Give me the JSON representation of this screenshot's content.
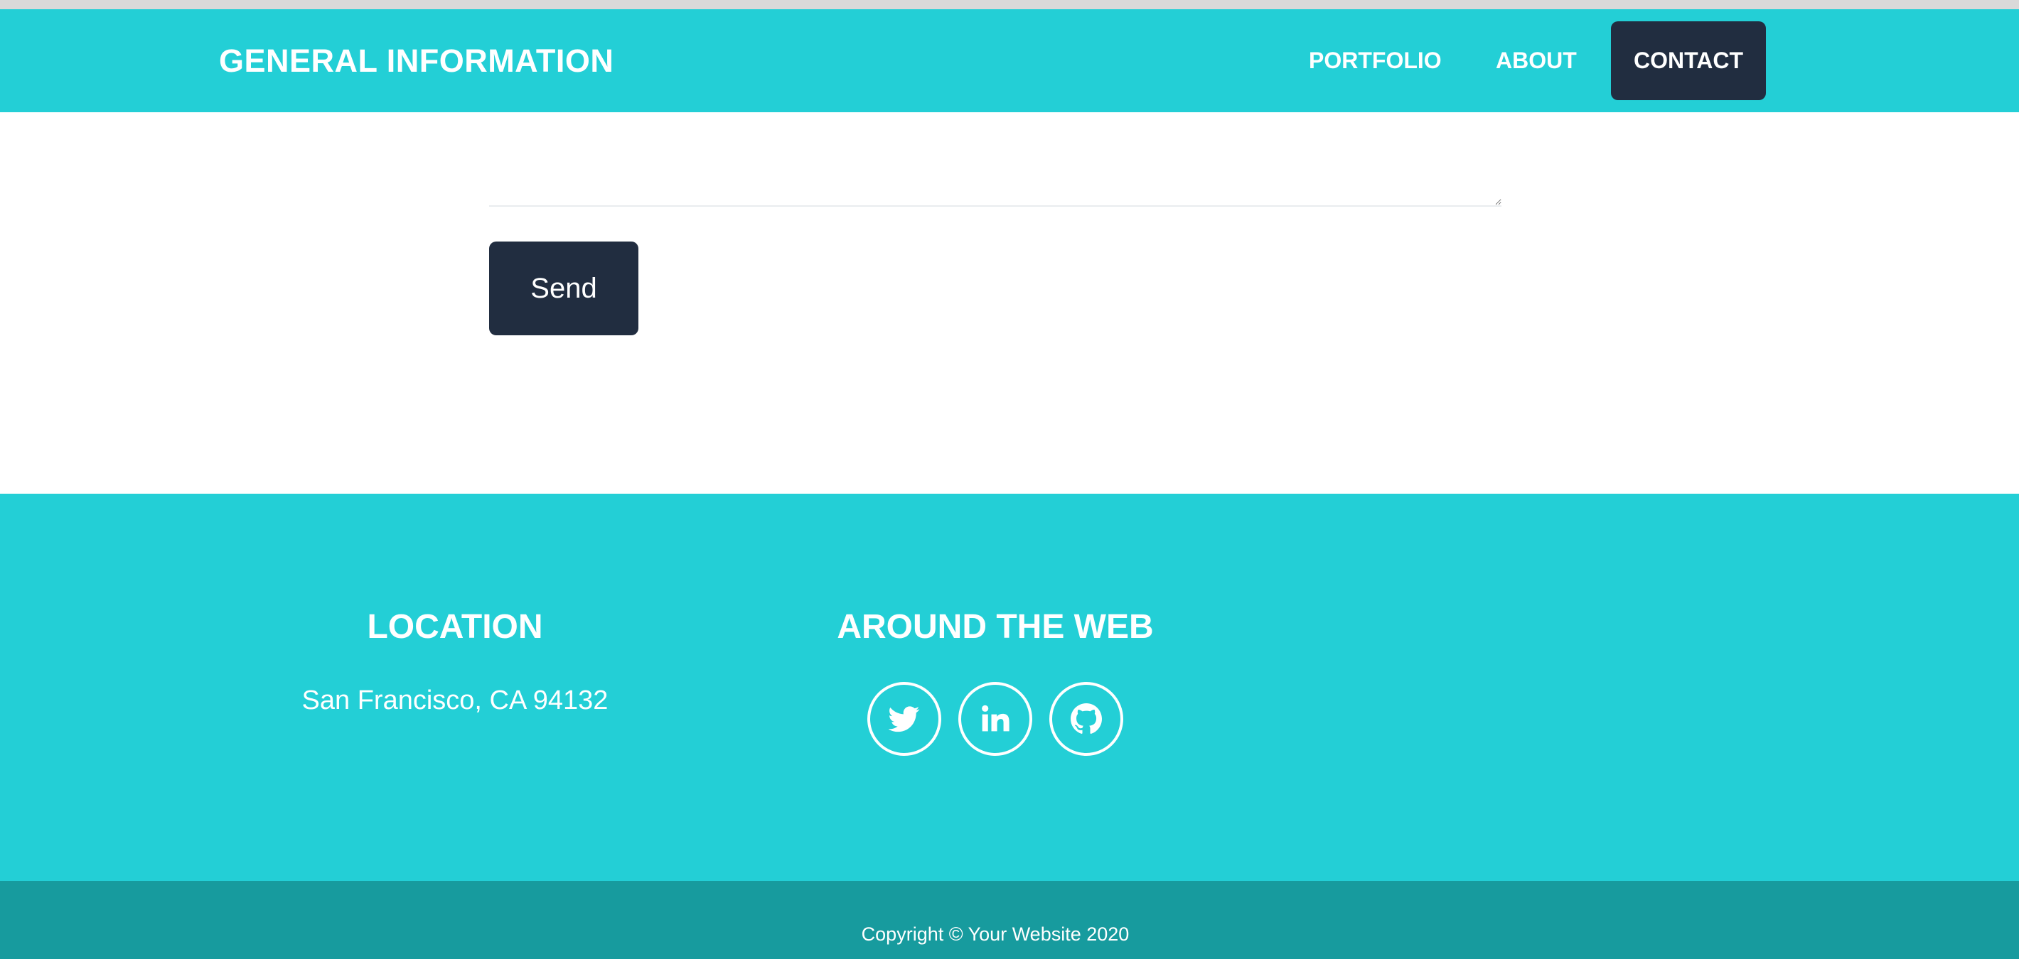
{
  "navbar": {
    "brand": "GENERAL INFORMATION",
    "links": [
      {
        "label": "PORTFOLIO"
      },
      {
        "label": "ABOUT"
      },
      {
        "label": "CONTACT",
        "active": true
      }
    ]
  },
  "form": {
    "send_label": "Send"
  },
  "footer": {
    "location": {
      "heading": "LOCATION",
      "text": "San Francisco, CA 94132"
    },
    "web": {
      "heading": "AROUND THE WEB",
      "icons": [
        "twitter-icon",
        "linkedin-icon",
        "github-icon"
      ]
    },
    "copyright": "Copyright © Your Website 2020"
  },
  "colors": {
    "primary": "#23cfd6",
    "dark": "#212d40",
    "copyright_bg": "#179b9e",
    "text_light": "#ffffff"
  }
}
